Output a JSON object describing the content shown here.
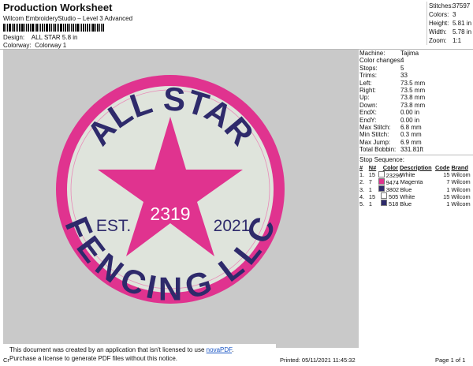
{
  "header": {
    "title": "Production Worksheet",
    "subtitle": "Wilcom EmbroideryStudio – Level 3 Advanced",
    "design_label": "Design:",
    "design_value": "ALL STAR 5.8 in",
    "colorway_label": "Colorway:",
    "colorway_value": "Colorway 1"
  },
  "summary": [
    {
      "k": "Stitches:",
      "v": "37597"
    },
    {
      "k": "Colors:",
      "v": "3"
    },
    {
      "k": "Height:",
      "v": "5.81 in"
    },
    {
      "k": "Width:",
      "v": "5.78 in"
    },
    {
      "k": "Zoom:",
      "v": "1:1"
    }
  ],
  "design_preview": {
    "top_text": "ALL STAR",
    "bottom_text": "FENCING LLC",
    "star_text": "2319",
    "left_text": "EST.",
    "right_text": "2021",
    "colors": {
      "border": "#e0338f",
      "fill": "#dfe4dc",
      "text": "#2e2a6b",
      "star": "#e0338f",
      "background": "#c9c9c9"
    }
  },
  "machine_info": [
    {
      "k": "Machine:",
      "v": "Tajima"
    },
    {
      "k": "Color changes:",
      "v": "4"
    },
    {
      "k": "Stops:",
      "v": "5"
    },
    {
      "k": "Trims:",
      "v": "33"
    },
    {
      "k": "Left:",
      "v": "73.5 mm"
    },
    {
      "k": "Right:",
      "v": "73.5 mm"
    },
    {
      "k": "Up:",
      "v": "73.8 mm"
    },
    {
      "k": "Down:",
      "v": "73.8 mm"
    },
    {
      "k": "EndX:",
      "v": "0.00 in"
    },
    {
      "k": "EndY:",
      "v": "0.00 in"
    },
    {
      "k": "Max Stitch:",
      "v": "6.8 mm"
    },
    {
      "k": "Min Stitch:",
      "v": "0.3 mm"
    },
    {
      "k": "Max Jump:",
      "v": "6.9 mm"
    },
    {
      "k": "Total Bobbin:",
      "v": "331.81ft"
    }
  ],
  "stop_sequence": {
    "label": "Stop Sequence:",
    "headers": [
      "#",
      "N#",
      "Color",
      "Description",
      "Code",
      "Brand"
    ],
    "rows": [
      {
        "num": "1.",
        "n": "15",
        "swatch": "#ffffff",
        "color": "23296",
        "desc": "White",
        "code": "15",
        "brand": "Wilcom"
      },
      {
        "num": "2.",
        "n": "7",
        "swatch": "#e0338f",
        "color": "9474",
        "desc": "Magenta",
        "code": "7",
        "brand": "Wilcom"
      },
      {
        "num": "3.",
        "n": "1",
        "swatch": "#2e2a6b",
        "color": "3802",
        "desc": "Blue",
        "code": "1",
        "brand": "Wilcom"
      },
      {
        "num": "4.",
        "n": "15",
        "swatch": "#ffffff",
        "color": "505",
        "desc": "White",
        "code": "15",
        "brand": "Wilcom"
      },
      {
        "num": "5.",
        "n": "1",
        "swatch": "#2e2a6b",
        "color": "518",
        "desc": "Blue",
        "code": "1",
        "brand": "Wilcom"
      }
    ]
  },
  "notice": {
    "line1_prefix": "This document was created by an application that isn't licensed to use ",
    "link": "novaPDF",
    "line1_suffix": ".",
    "line2": "Purchase a license to generate PDF files without this notice."
  },
  "footer": {
    "left": "Cr",
    "printed": "Printed: 05/11/2021 11:45:32",
    "page": "Page 1 of 1"
  }
}
